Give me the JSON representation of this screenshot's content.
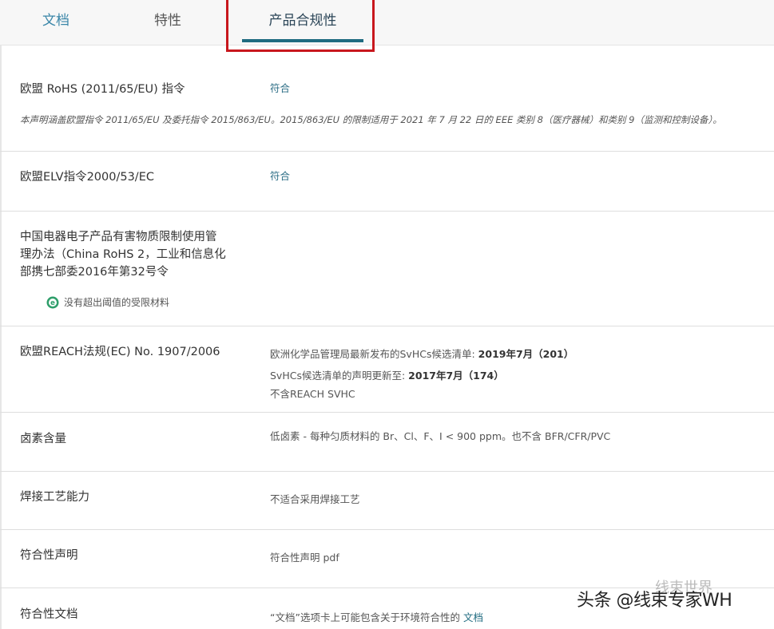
{
  "tabs": {
    "docs": "文档",
    "features": "特性",
    "compliance": "产品合规性"
  },
  "rows": {
    "rohs_eu": {
      "label": "欧盟 RoHS (2011/65/EU) 指令",
      "value": "符合",
      "note": "本声明涵盖欧盟指令 2011/65/EU 及委托指令 2015/863/EU。2015/863/EU 的限制适用于 2021 年 7 月 22 日的 EEE 类别 8（医疗器械）和类别 9（监测和控制设备）。"
    },
    "elv": {
      "label": "欧盟ELV指令2000/53/EC",
      "value": "符合"
    },
    "china_rohs": {
      "label_line1": "中国电器电子产品有害物质限制使用管",
      "label_line2": "理办法（China RoHS 2，工业和信息化",
      "label_line3": "部携七部委2016年第32号令",
      "badge": "没有超出阈值的受限材料"
    },
    "reach": {
      "label": "欧盟REACH法规(EC) No. 1907/2006",
      "line1_text": "欧洲化学品管理局最新发布的SvHCs候选清单: ",
      "line1_bold": "2019年7月（201）",
      "line2_text": "SvHCs候选清单的声明更新至: ",
      "line2_bold": "2017年7月（174）",
      "line3": "不含REACH SVHC"
    },
    "halogen": {
      "label": "卤素含量",
      "value": "低卤素 - 每种匀质材料的 Br、Cl、F、I < 900 ppm。也不含 BFR/CFR/PVC"
    },
    "solder": {
      "label": "焊接工艺能力",
      "value": "不适合采用焊接工艺"
    },
    "declaration": {
      "label": "符合性声明",
      "value": "符合性声明 pdf"
    },
    "doc": {
      "label": "符合性文档",
      "value_text": "“文档”选项卡上可能包含关于环境符合性的 ",
      "value_link": "文档"
    }
  },
  "watermark": {
    "text": "头条 @线束专家WH",
    "ghost": "线束世界"
  },
  "colors": {
    "accent": "#1f6b80",
    "highlight": "#c8171d",
    "badge_green": "#2e9e6a"
  }
}
